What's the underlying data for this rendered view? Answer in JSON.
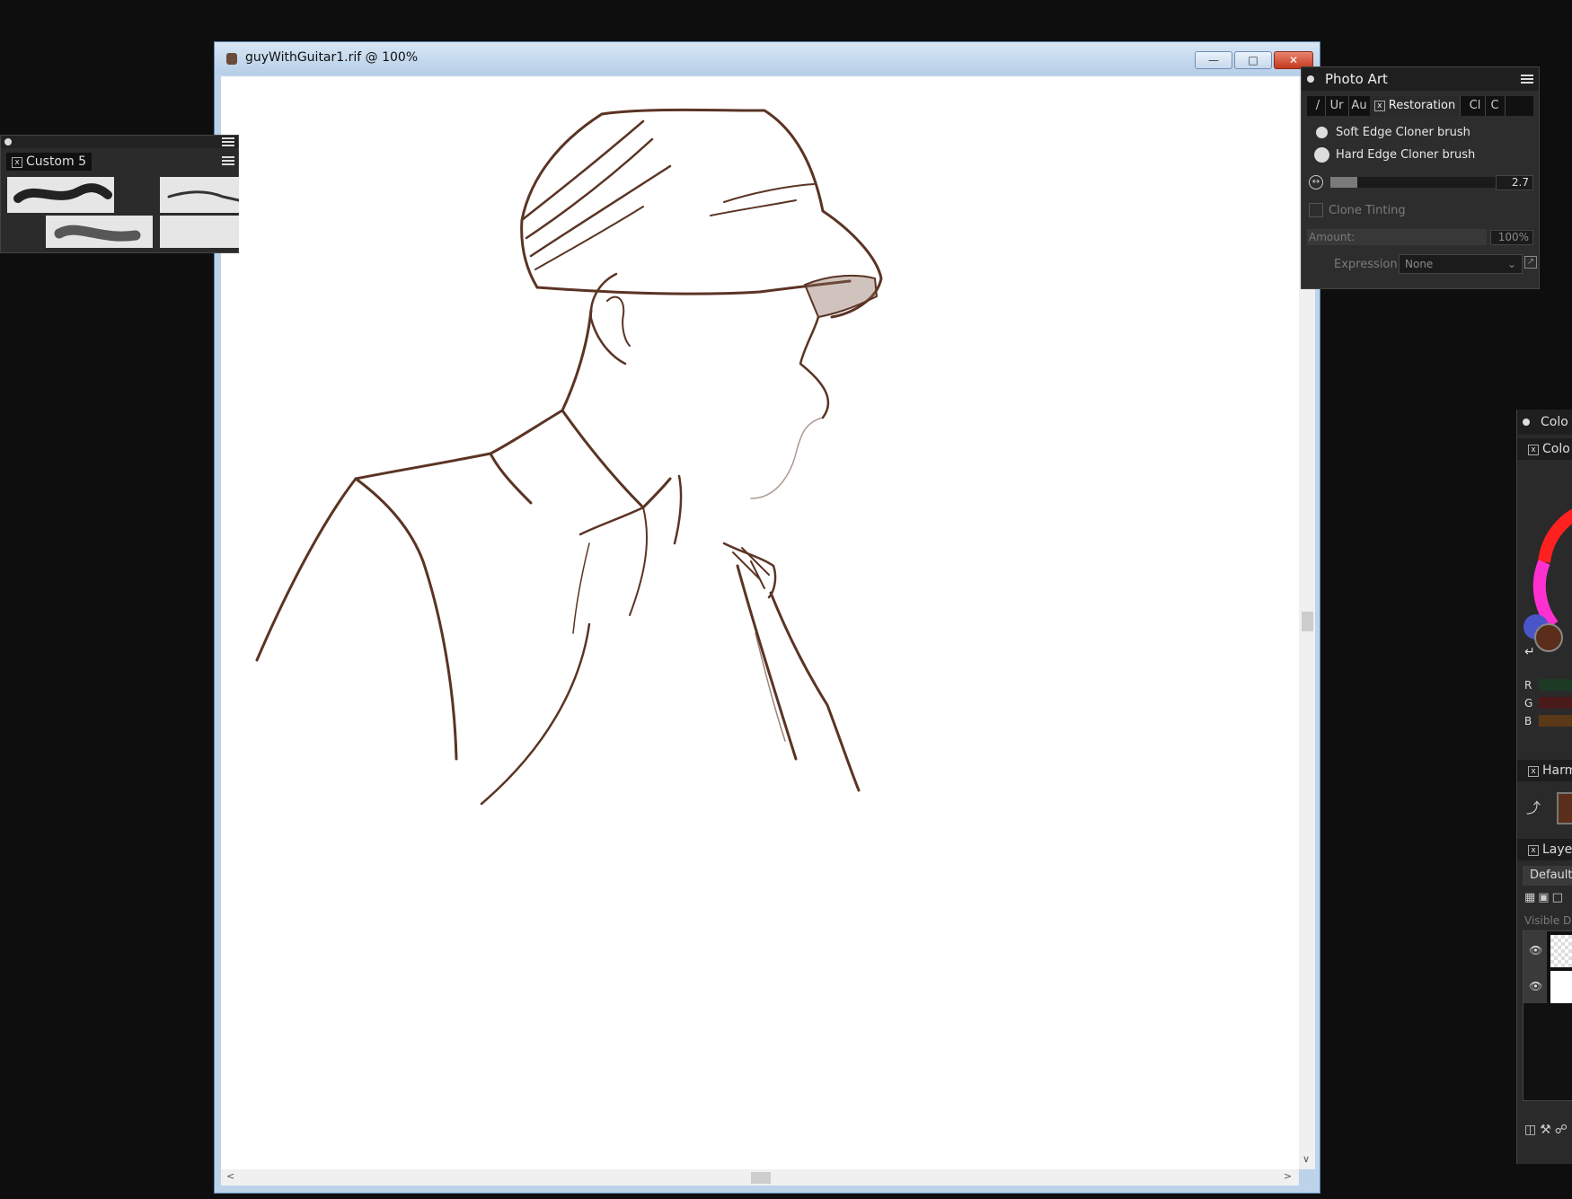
{
  "document": {
    "title": "guyWithGuitar1.rif @ 100%",
    "minimize_icon": "minimize-icon",
    "maximize_icon": "maximize-icon",
    "close_icon": "close-icon"
  },
  "custom_palette": {
    "tab_label": "Custom 5"
  },
  "photo_art": {
    "title": "Photo Art",
    "tabs": [
      "/",
      "Ur",
      "Au",
      "Restoration",
      "Cl",
      "C"
    ],
    "active_tab": "Restoration",
    "brushes": [
      "Soft Edge Cloner brush",
      "Hard Edge Cloner brush"
    ],
    "size_value": "2.7",
    "clone_tinting_label": "Clone Tinting",
    "amount_label": "Amount:",
    "amount_value": "100%",
    "expression_label": "Expression:",
    "expression_value": "None"
  },
  "colors_panel": {
    "title": "Colo",
    "color_tab": "Colo",
    "rgb_labels": [
      "R",
      "G",
      "B"
    ],
    "harmony_tab": "Harm",
    "layers_tab": "Layer",
    "layers_preset": "Default",
    "visible_label": "Visible De",
    "primary_color": "#5a2e1a",
    "secondary_color": "#4a55c8"
  },
  "colors": {
    "sketch_stroke": "#5b3424",
    "titlebar": "#c6daef",
    "close_button": "#c2391d"
  }
}
